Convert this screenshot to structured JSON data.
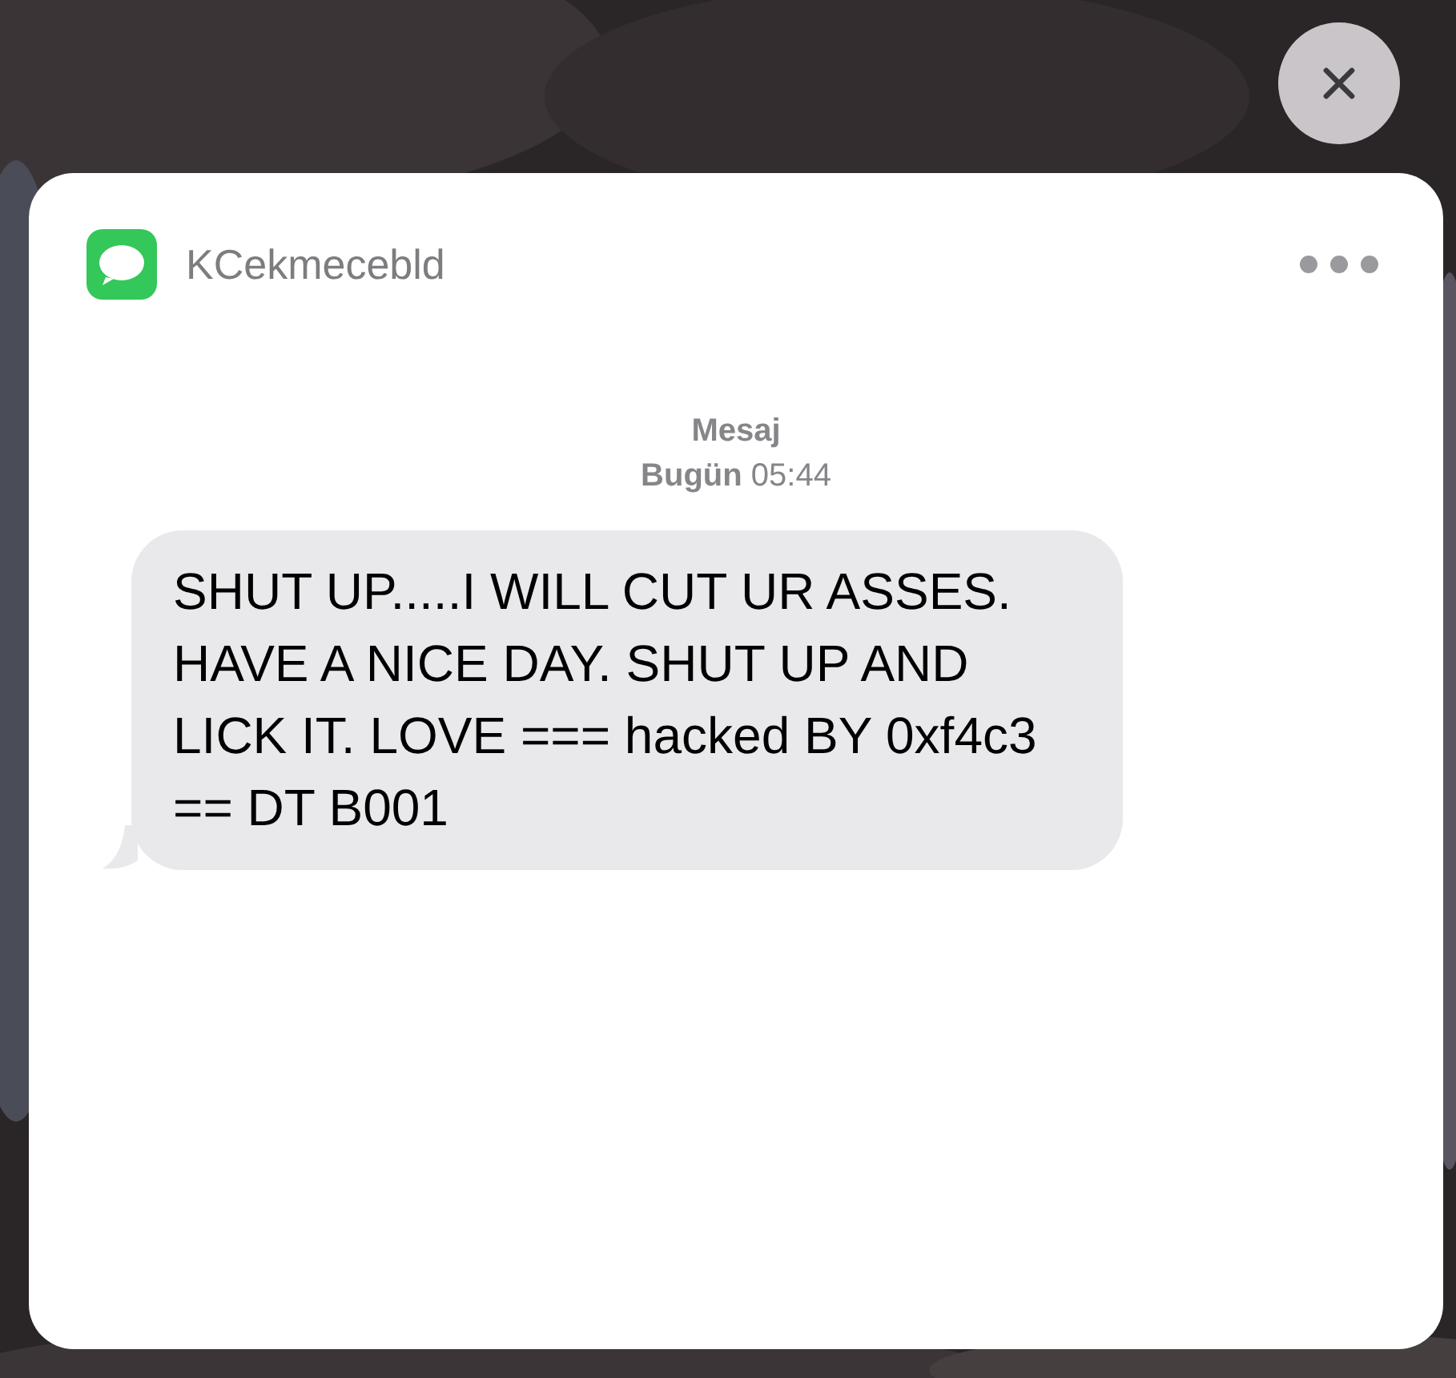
{
  "notification": {
    "app_name": "KCekmecebld",
    "service": "Mesaj",
    "timestamp": "**Bugün** 05:44",
    "messages": [
      {
        "text": "SHUT UP.....I WILL CUT UR ASSES. HAVE A NICE DAY. SHUT UP AND LICK IT. LOVE === hacked BY 0xf4c3 == DT B001"
      }
    ]
  }
}
